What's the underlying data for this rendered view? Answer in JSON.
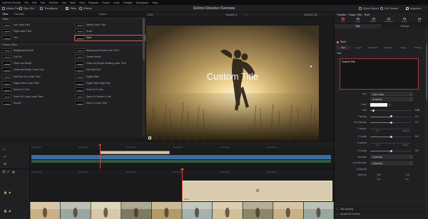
{
  "menubar": [
    "DaVinci Resolve",
    "File",
    "Edit",
    "Trim",
    "Timeline",
    "Clip",
    "Mark",
    "View",
    "Playback",
    "Fusion",
    "Color",
    "Fairlight",
    "Workspace",
    "Help"
  ],
  "app_title": "DaVinci Resolve Overview",
  "toolbar": {
    "left": [
      {
        "label": "Media Pool",
        "icon": "media-pool-icon"
      },
      {
        "label": "Sync Bin",
        "icon": "sync-bin-icon"
      },
      {
        "label": "Transitions",
        "icon": "transitions-icon"
      },
      {
        "label": "Titles",
        "icon": "titles-icon",
        "active": true
      },
      {
        "label": "Effects",
        "icon": "effects-icon"
      }
    ],
    "right": [
      {
        "label": "Quick Export",
        "icon": "export-icon"
      },
      {
        "label": "Full Screen",
        "icon": "fullscreen-icon"
      },
      {
        "label": "Inspector",
        "icon": "inspector-icon",
        "active": true
      }
    ]
  },
  "left_panel": {
    "tabs": [
      "Titles",
      "Favorites"
    ],
    "search_label": "Search",
    "sections": [
      {
        "title": "Titles",
        "items": [
          "Left Lower Third",
          "Middle Lower Third",
          "Right Lower Third",
          "Scroll",
          "Text",
          "Text+"
        ]
      },
      {
        "title": "Fusion Titles",
        "items": [
          "Background Reveal",
          "Background Reveal Lower Third",
          "Call Out",
          "Center Reveal",
          "Clean and Simple",
          "Clean and Simple Heading Lower Third",
          "Clean and Simple Lower Third",
          "Dark Box Text",
          "Dark Box Text Lower Third",
          "Digital Glitch",
          "Digital Glitch Lower Third",
          "Digital Glitch Right Side",
          "Draw On 1 Line",
          "Draw On 2 Lines",
          "Draw On 2 Lines Lower Third",
          "Draw On Corners 1 Line",
          "Dropoff",
          "Draw In Lower Third"
        ]
      }
    ],
    "selected_item": "Text+"
  },
  "viewer": {
    "zoom": "21%",
    "timeline_name": "Timeline 1",
    "source_timecode": "00:00:21:00",
    "overlay_text": "Custom Title",
    "timecode": "00:00:04:21"
  },
  "inspector": {
    "title": "Timeline - Fusion Title - Text+",
    "top_tabs": [
      "Video",
      "Audio",
      "Effects",
      "Transition",
      "Image",
      "File"
    ],
    "active_top_tab": "Video",
    "sub_tabs": [
      "Title",
      "Settings"
    ],
    "active_sub_tab": "Title",
    "node_name": "Text+",
    "node_tabs": [
      "Text",
      "Layout",
      "Transform",
      "Shading",
      "Image",
      "Settings"
    ],
    "active_node_tab": "Text",
    "text_section": "Text",
    "styled_text": "Custom Title",
    "font": "Open Sans",
    "style": "Semibold",
    "color_label": "Color",
    "rows": [
      {
        "label": "Size",
        "value": "0.08",
        "level": 0.08
      },
      {
        "label": "Tracking",
        "value": "1.0",
        "level": 0.5
      },
      {
        "label": "Line Spacing",
        "value": "1.0",
        "level": 0.5
      },
      {
        "label": "V Anchor",
        "value": "",
        "pair": [
          "Top",
          "Bottom"
        ]
      },
      {
        "label": "V Justify",
        "value": "0.0",
        "level": 0.5
      },
      {
        "label": "H Anchor",
        "value": "",
        "pair": [
          "Left",
          "Right"
        ]
      },
      {
        "label": "H Justify",
        "value": "0.0",
        "level": 0.5
      },
      {
        "label": "Direction",
        "dropdown": "Automatic"
      },
      {
        "label": "Line Direction",
        "dropdown": "Automatic"
      },
      {
        "label": "Emphasis",
        "value": ""
      },
      {
        "label": "Write On",
        "range": [
          "0.0",
          "1.0"
        ],
        "range_labels": [
          "Start",
          "End"
        ]
      }
    ],
    "collapsed": [
      "Tab Spacing",
      "Advanced Controls"
    ],
    "font_label": "Font",
    "size_label": "Size"
  },
  "timeline": {
    "ruler_times": [
      "01:00:00:00",
      "01:00:04:00",
      "01:00:08:00",
      "01:00:12:00",
      "01:00:16:00",
      "01:00:20:00"
    ],
    "title_clip_label": "Text+",
    "lower_clip_label": "Text+",
    "lower_timecode": "01:00:05:00"
  }
}
